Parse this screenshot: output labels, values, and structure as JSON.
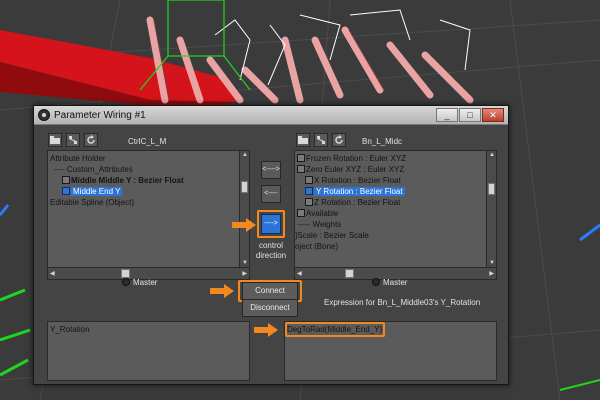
{
  "dialog": {
    "title": "Parameter Wiring #1",
    "window_buttons": {
      "minimize": "_",
      "maximize": "□",
      "close": "✕"
    }
  },
  "left_panel": {
    "name": "CtrlC_L_M",
    "tree": [
      {
        "label": "Attribute Holder",
        "prefix": "",
        "selected": false,
        "bold": false
      },
      {
        "label": "Custom_Attributes",
        "prefix": "---- ",
        "selected": false,
        "bold": false
      },
      {
        "label": "Middle Middle Y : Bezier Float",
        "prefix": "",
        "selected": false,
        "bold": true
      },
      {
        "label": "Middle End Y",
        "prefix": "",
        "selected": true,
        "bold": false
      },
      {
        "label": "Editable Spline (Object)",
        "prefix": "",
        "selected": false,
        "bold": false
      }
    ],
    "master_label": "Master",
    "expression": "Y_Rotation"
  },
  "right_panel": {
    "name": "Bn_L_Midc",
    "tree": [
      {
        "label": "Frozen Rotation : Euler XYZ",
        "selected": false
      },
      {
        "label": "Zero Euler XYZ : Euler XYZ",
        "selected": false
      },
      {
        "label": "X Rotation : Bezier Float",
        "selected": false
      },
      {
        "label": "Y Rotation : Bezier Float",
        "selected": true
      },
      {
        "label": "Z Rotation : Bezier Float",
        "selected": false
      },
      {
        "label": "Available",
        "selected": false
      },
      {
        "label": "Weights",
        "selected": false
      },
      {
        "label": "Scale : Bezier Scale",
        "selected": false
      },
      {
        "label": "oject (Bone)",
        "selected": false
      }
    ],
    "master_label": "Master",
    "expression": "DegToRad(Middle_End_Y)"
  },
  "direction_buttons": [
    {
      "label": "<---->"
    },
    {
      "label": "<----"
    },
    {
      "label": "---->"
    }
  ],
  "control_direction_label": "control\ndirection",
  "connect_label": "Connect",
  "disconnect_label": "Disconnect",
  "expression_label": "Expression for Bn_L_Middle03's Y_Rotation",
  "colors": {
    "highlight": "#f2891f",
    "selection": "#2c74d6",
    "dialog_bg": "#444444",
    "field_bg": "#5b5b5b"
  }
}
